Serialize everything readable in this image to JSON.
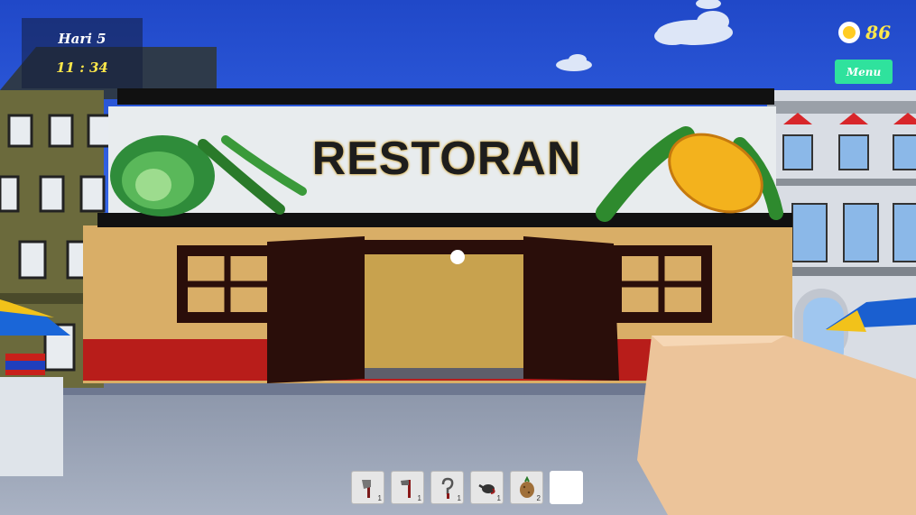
{
  "hud": {
    "day_label": "Hari 5",
    "time": "11 : 34",
    "coins": "86",
    "menu_label": "Menu"
  },
  "scene": {
    "sign_text": "RESTORAN",
    "sky_color": "#2a55d8",
    "wall_color": "#d9ae67",
    "door_color": "#2a0e0a"
  },
  "hotbar": {
    "slots": [
      {
        "icon": "axe-icon",
        "count": "1"
      },
      {
        "icon": "hatchet-icon",
        "count": "1"
      },
      {
        "icon": "hook-icon",
        "count": "1"
      },
      {
        "icon": "watering-can-icon",
        "count": "1"
      },
      {
        "icon": "potato-icon",
        "count": "2"
      },
      {
        "icon": "empty",
        "count": ""
      }
    ]
  }
}
